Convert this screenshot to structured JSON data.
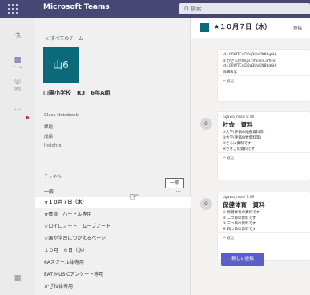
{
  "app": {
    "title": "Microsoft Teams",
    "search_placeholder": "Q 検索"
  },
  "rail": {
    "items": [
      {
        "icon": "activity-icon",
        "label": ""
      },
      {
        "icon": "teams-icon",
        "label": "チーム"
      },
      {
        "icon": "assignments-icon",
        "label": "課題"
      },
      {
        "icon": "more-icon",
        "label": "..."
      },
      {
        "icon": "apps-icon",
        "label": ""
      }
    ]
  },
  "team_pane": {
    "back_label": "< すべてのチーム",
    "team_logo_text": "山6",
    "team_name": "山陽小学校　R3　6年A組",
    "nav_items": [
      "Class Notebook",
      "課題",
      "成績",
      "Insights"
    ],
    "channels_heading": "チャネル",
    "channels": [
      "一般",
      "★１０月７日（木）",
      "★体育　ハードル専用",
      "☆ロイロノート　ムーブノート",
      "☆国や学習につかえるページ",
      "１０月　６日（水）",
      "6Aスクール体専用",
      "EAT MUSICアンケート専用",
      "かざね体専用"
    ],
    "more_label": "···",
    "tooltip": "一般"
  },
  "main": {
    "channel_title": "★１０月７日（木）",
    "tab_label": "投稿",
    "posts": [
      {
        "author": "",
        "subject": "",
        "lines": [
          "id=00WTCsiD0q3UvKN8bg6H",
          "② かざる体htips://forms.office",
          "id=00WTCsiD0q3UvKN8bg6H",
          "詳細表示"
        ],
        "reply": "↩ 返信"
      },
      {
        "author": "ogawa_mosi  8:40",
        "subject": "社会　資料",
        "lines": [
          "①大学(評価の順番資料等)",
          "②大学(評価の数資料等)",
          "③さらに資料です",
          "④さきこの資料です"
        ],
        "reply": "↩ 返信"
      },
      {
        "author": "ogawa_mosi  7:09",
        "subject": "保健体育　資料",
        "lines": [
          "① 保健体育の資料です",
          "② 二つ目の資料です",
          "③ 三つ目の資料です",
          "④ 四つ目の資料です"
        ],
        "reply": "↩ 返信"
      }
    ],
    "avatar_letter": "O",
    "new_post_label": "新しい投稿"
  }
}
